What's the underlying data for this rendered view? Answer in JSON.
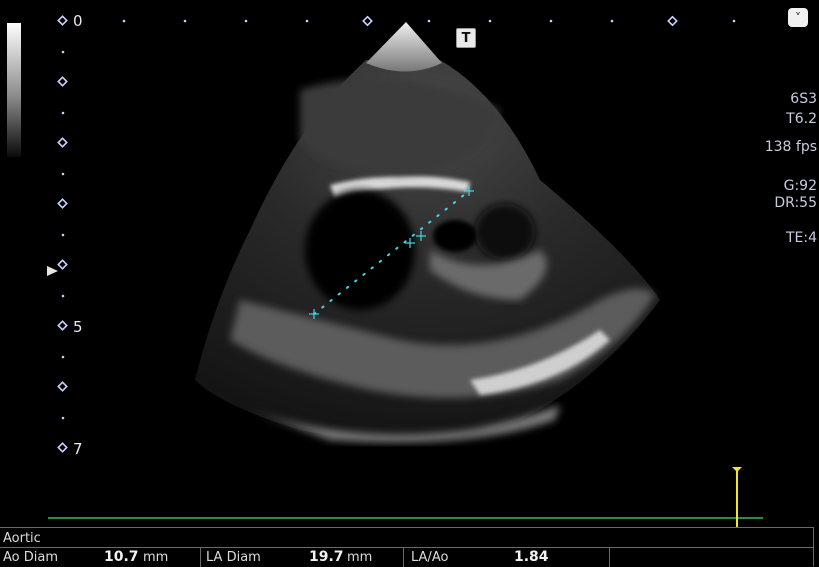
{
  "depth_scale": {
    "top_label": "0",
    "mid_label": "5",
    "bottom_label": "7"
  },
  "imaging_params": {
    "probe": "6S3",
    "frequency": "T6.2",
    "frame_rate": "138 fps",
    "gain": "G:92",
    "dynamic_range": "DR:55",
    "te": "TE:4"
  },
  "markers": {
    "t_marker": "T",
    "menu_glyph": "˅"
  },
  "colors": {
    "caliper": "#41d6e6",
    "ecg_trace": "#3fe07a",
    "ecg_cursor": "#f2e62a",
    "scale_dots": "#c8d2ff"
  },
  "measurement_panel": {
    "title": "Aortic",
    "items": [
      {
        "label": "Ao Diam",
        "value": "10.7",
        "unit": "mm"
      },
      {
        "label": "LA Diam",
        "value": "19.7",
        "unit": "mm"
      },
      {
        "label": "LA/Ao",
        "value": "1.84",
        "unit": ""
      }
    ]
  }
}
